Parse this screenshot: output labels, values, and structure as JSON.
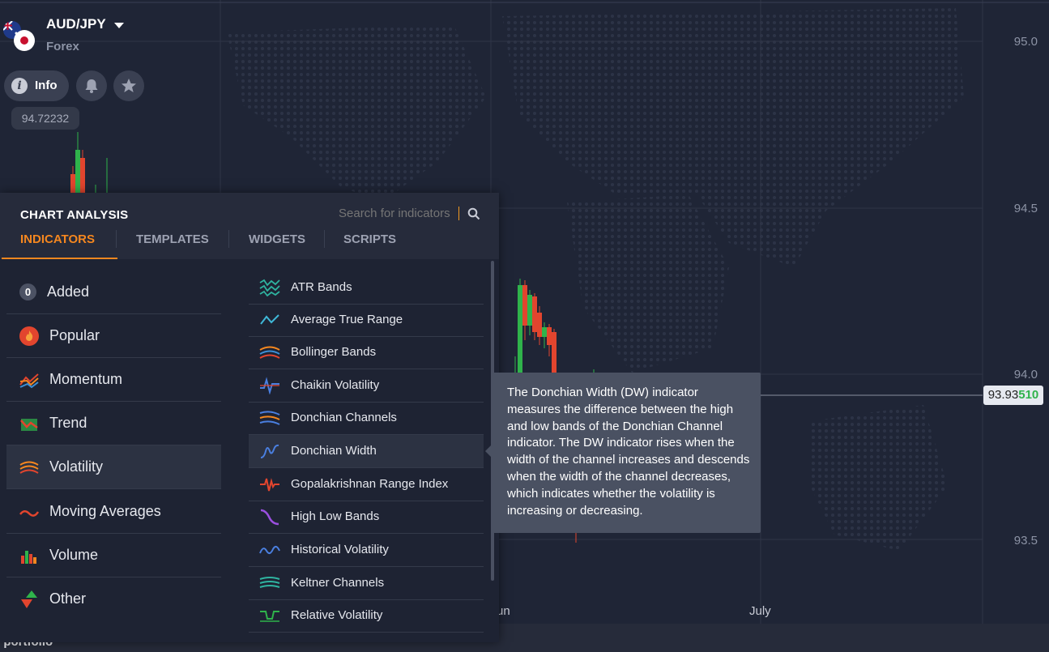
{
  "asset": {
    "name": "AUD/JPY",
    "type": "Forex",
    "info_label": "Info",
    "quote": "94.72232"
  },
  "price_axis": [
    "95.0",
    "94.5",
    "94.0",
    "93.5"
  ],
  "time_axis": [
    "un",
    "July"
  ],
  "current_price": {
    "main": "93.93",
    "highlight": "510"
  },
  "bottom_label": "l portfolio",
  "panel": {
    "title": "CHART ANALYSIS",
    "search_placeholder": "Search for indicators",
    "tabs": [
      "INDICATORS",
      "TEMPLATES",
      "WIDGETS",
      "SCRIPTS"
    ],
    "categories": [
      {
        "label": "Added",
        "badge": "0",
        "icon": "counter-badge"
      },
      {
        "label": "Popular",
        "icon": "fire-icon"
      },
      {
        "label": "Momentum",
        "icon": "momentum-icon"
      },
      {
        "label": "Trend",
        "icon": "trend-icon"
      },
      {
        "label": "Volatility",
        "icon": "volatility-icon"
      },
      {
        "label": "Moving Averages",
        "icon": "moving-average-icon"
      },
      {
        "label": "Volume",
        "icon": "volume-icon"
      },
      {
        "label": "Other",
        "icon": "other-icon"
      }
    ],
    "indicators": [
      "ATR Bands",
      "Average True Range",
      "Bollinger Bands",
      "Chaikin Volatility",
      "Donchian Channels",
      "Donchian Width",
      "Gopalakrishnan Range Index",
      "High Low Bands",
      "Historical Volatility",
      "Keltner Channels",
      "Relative Volatility"
    ]
  },
  "tooltip": "The Donchian Width (DW) indicator measures the difference between the high and low bands of the Donchian Channel indicator. The DW indicator rises when the width of the channel increases and descends when the width of the channel decreases, which indicates whether the volatility is increasing or decreasing.",
  "colors": {
    "accent": "#f5871f",
    "up": "#2fb34b",
    "down": "#e2452e"
  }
}
